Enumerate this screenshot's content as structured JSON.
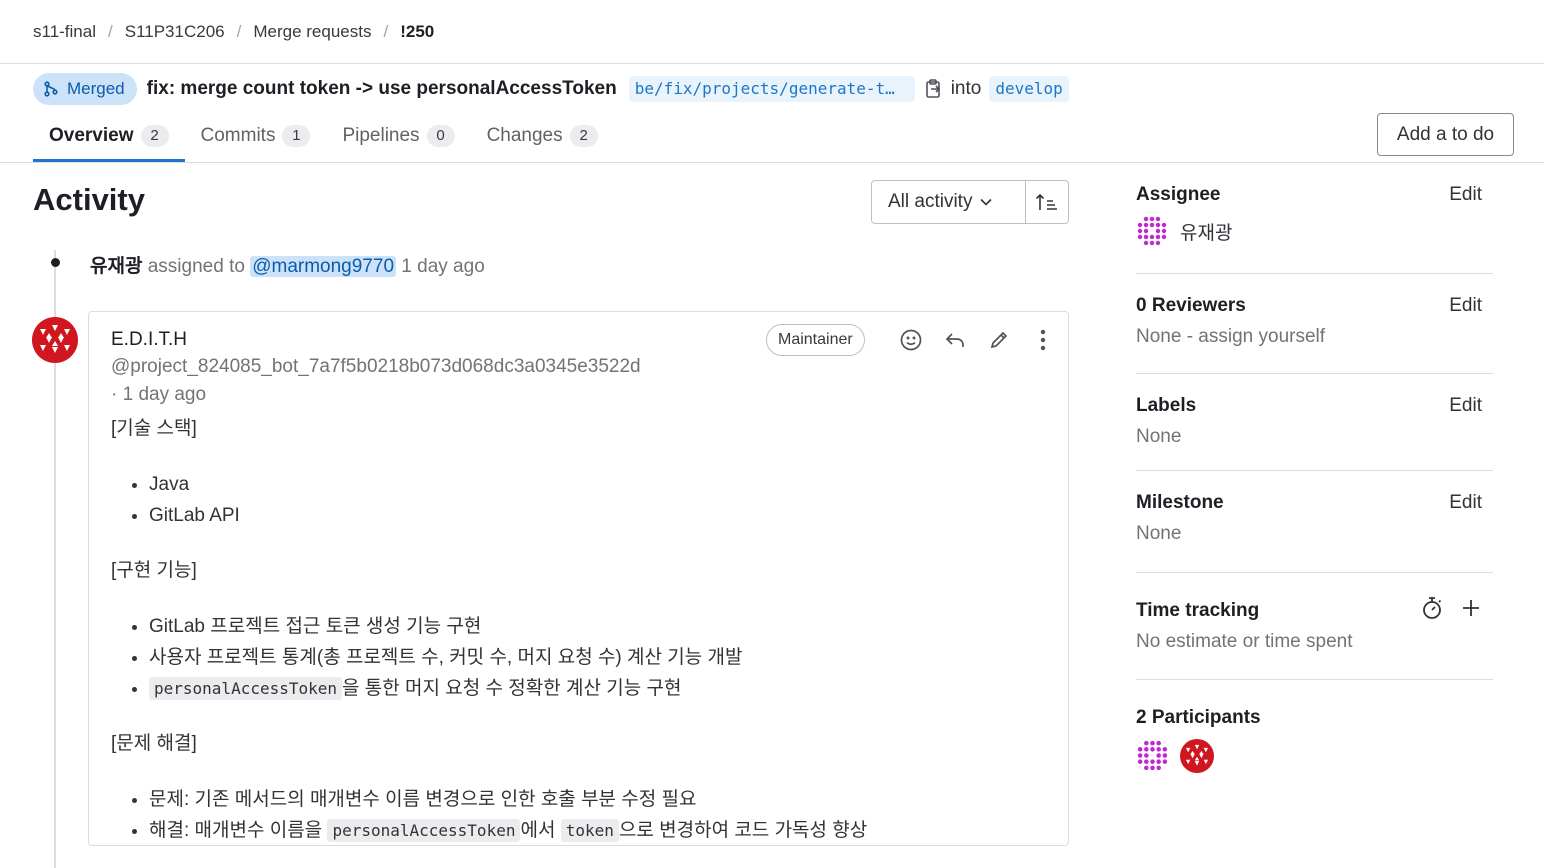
{
  "breadcrumb": {
    "group": "s11-final",
    "project": "S11P31C206",
    "section": "Merge requests",
    "item": "!250"
  },
  "header": {
    "status": "Merged",
    "title": "fix: merge count token -> use personalAccessToken",
    "source_branch": "be/fix/projects/generate-t…",
    "into": "into",
    "target_branch": "develop"
  },
  "tabs": [
    {
      "label": "Overview",
      "count": "2"
    },
    {
      "label": "Commits",
      "count": "1"
    },
    {
      "label": "Pipelines",
      "count": "0"
    },
    {
      "label": "Changes",
      "count": "2"
    }
  ],
  "todo_button": "Add a to do",
  "activity": {
    "title": "Activity",
    "filter": "All activity",
    "event": {
      "author": "유재광",
      "text": "assigned to",
      "mention": "@marmong9770",
      "time": "1 day ago"
    }
  },
  "note": {
    "author": "E.D.I.T.H",
    "handle": "@project_824085_bot_7a7f5b0218b073d068dc3a0345e3522d",
    "time": "· 1 day ago",
    "role": "Maintainer",
    "heading1": "[기술 스택]",
    "stack": [
      "Java",
      "GitLab API"
    ],
    "heading2": "[구현 기능]",
    "features": {
      "f1": "GitLab 프로젝트 접근 토큰 생성 기능 구현",
      "f2": "사용자 프로젝트 통계(총 프로젝트 수, 커밋 수, 머지 요청 수) 계산 기능 개발",
      "f3_code": "personalAccessToken",
      "f3_text": "을 통한 머지 요청 수 정확한 계산 기능 구현"
    },
    "heading3": "[문제 해결]",
    "problem": "문제: 기존 메서드의 매개변수 이름 변경으로 인한 호출 부분 수정 필요",
    "solution": {
      "prefix": "해결: 매개변수 이름을 ",
      "code1": "personalAccessToken",
      "middle": "에서 ",
      "code2": "token",
      "suffix": "으로 변경하여 코드 가독성 향상"
    }
  },
  "sidebar": {
    "assignee": {
      "title": "Assignee",
      "edit": "Edit",
      "name": "유재광"
    },
    "reviewers": {
      "title": "0 Reviewers",
      "edit": "Edit",
      "value": "None - assign yourself"
    },
    "labels": {
      "title": "Labels",
      "edit": "Edit",
      "value": "None"
    },
    "milestone": {
      "title": "Milestone",
      "edit": "Edit",
      "value": "None"
    },
    "time_tracking": {
      "title": "Time tracking",
      "value": "No estimate or time spent"
    },
    "participants": {
      "title": "2 Participants"
    }
  },
  "colors": {
    "accent": "#1f75cb",
    "merged_bg": "#cbe2f9",
    "merged_text": "#0b5cad",
    "avatar_purple": "#c026d3",
    "avatar_red": "#d0161f"
  }
}
